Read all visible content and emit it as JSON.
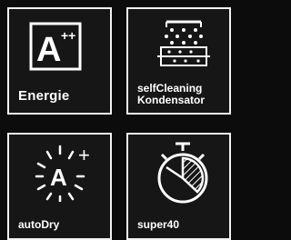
{
  "tiles": [
    {
      "label": "Energie",
      "icon": "energy-rating-icon",
      "rating_letter": "A",
      "rating_plus": "++"
    },
    {
      "label_line1": "selfCleaning",
      "label_line2": "Kondensator",
      "icon": "self-cleaning-condenser-icon"
    },
    {
      "label": "autoDry",
      "icon": "auto-dry-icon",
      "letter": "A",
      "plus": "+"
    },
    {
      "label": "super40",
      "icon": "stopwatch-icon"
    }
  ],
  "colors": {
    "background": "#0c0c0c",
    "tile": "#161616",
    "border": "#f2f2f2",
    "text": "#ffffff"
  }
}
